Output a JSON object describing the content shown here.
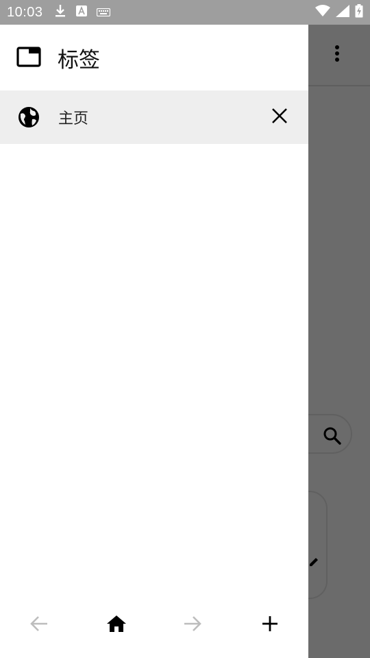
{
  "status_bar": {
    "time": "10:03",
    "left_icons": [
      "download-icon",
      "text-a-icon",
      "keyboard-icon"
    ],
    "right_icons": [
      "wifi-icon",
      "signal-icon",
      "battery-charging-icon"
    ]
  },
  "drawer": {
    "title": "标签",
    "title_icon": "tab-icon",
    "tabs": [
      {
        "label": "主页",
        "icon": "globe-icon",
        "close_icon": "close-icon",
        "selected": true
      }
    ],
    "bottom_nav": [
      {
        "name": "back",
        "icon": "arrow-left-icon",
        "enabled": false
      },
      {
        "name": "home",
        "icon": "home-icon",
        "enabled": true
      },
      {
        "name": "forward",
        "icon": "arrow-right-icon",
        "enabled": false
      },
      {
        "name": "new-tab",
        "icon": "plus-icon",
        "enabled": true
      }
    ]
  },
  "background": {
    "icons": [
      "more-vertical-icon",
      "search-icon",
      "edit-icon"
    ]
  },
  "colors": {
    "status_bar": "#9e9e9e",
    "scrim": "#6b6b6b",
    "drawer_bg": "#ffffff",
    "selected_tab_bg": "#eeeeee",
    "disabled_icon": "#bdbdbd",
    "icon": "#000000"
  }
}
